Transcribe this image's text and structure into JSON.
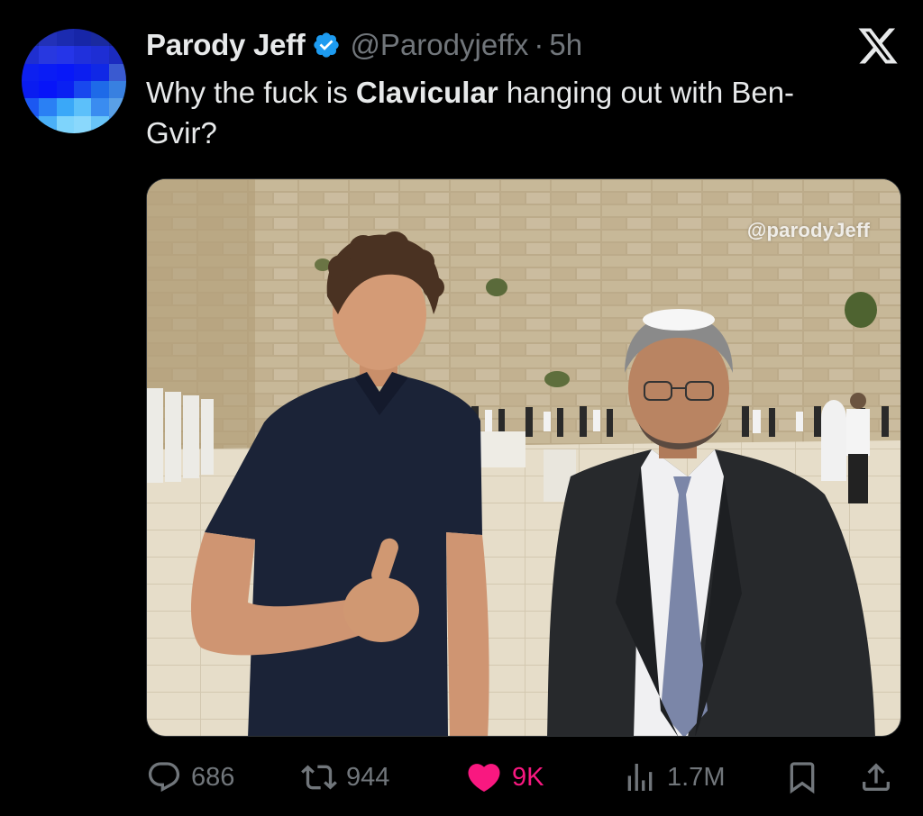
{
  "tweet": {
    "display_name": "Parody Jeff",
    "handle": "@Parodyjeffx",
    "separator": "·",
    "time": "5h",
    "text_before": "Why the fuck is ",
    "text_bold": "Clavicular",
    "text_after": " hanging out with Ben-Gvir?",
    "media_watermark": "@parodyJeff",
    "verified": true
  },
  "actions": {
    "replies": "686",
    "reposts": "944",
    "likes": "9K",
    "views": "1.7M"
  },
  "icons": {
    "logo": "x-logo-icon",
    "verified": "verified-badge-icon",
    "reply": "reply-icon",
    "repost": "repost-icon",
    "like": "heart-icon",
    "views": "analytics-icon",
    "bookmark": "bookmark-icon",
    "share": "share-icon"
  },
  "colors": {
    "background": "#000000",
    "text": "#e7e9ea",
    "secondary_text": "#71767b",
    "verified_blue": "#1d9bf0",
    "like_pink": "#f91880"
  }
}
